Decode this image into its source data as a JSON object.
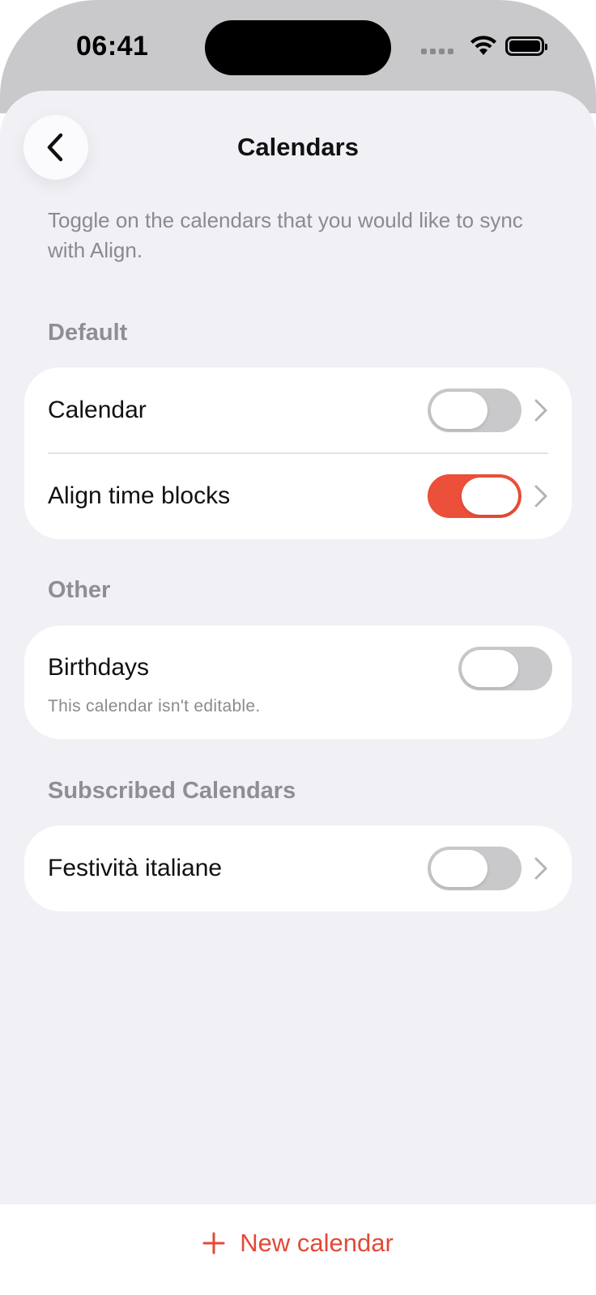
{
  "status_bar": {
    "time": "06:41"
  },
  "nav": {
    "title": "Calendars",
    "back_icon": "chevron-left-icon"
  },
  "intro": "Toggle on the calendars that you would like to sync with Align.",
  "sections": [
    {
      "title": "Default",
      "items": [
        {
          "label": "Calendar",
          "enabled": false,
          "has_chevron": true
        },
        {
          "label": "Align time blocks",
          "enabled": true,
          "has_chevron": true
        }
      ]
    },
    {
      "title": "Other",
      "items": [
        {
          "label": "Birthdays",
          "subtitle": "This calendar isn't editable.",
          "enabled": false,
          "has_chevron": false
        }
      ]
    },
    {
      "title": "Subscribed Calendars",
      "items": [
        {
          "label": "Festività italiane",
          "enabled": false,
          "has_chevron": true
        }
      ]
    }
  ],
  "footer": {
    "new_calendar_label": "New calendar",
    "icon": "plus-icon"
  },
  "colors": {
    "accent": "#ec4f3a",
    "background": "#f1f0f5",
    "toggle_off": "#c9c9cb"
  }
}
